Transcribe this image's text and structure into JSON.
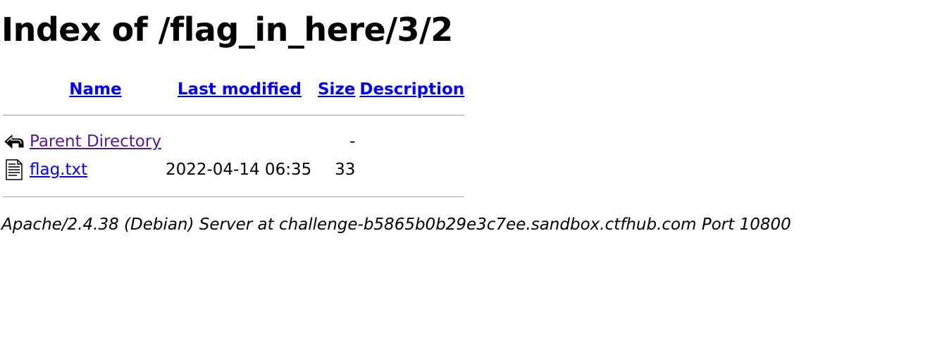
{
  "title": "Index of /flag_in_here/3/2",
  "columns": {
    "name": "Name",
    "last_modified": "Last modified",
    "size": "Size",
    "description": "Description"
  },
  "entries": [
    {
      "icon": "back-arrow-icon",
      "name": "Parent Directory",
      "last_modified": "",
      "size": "-",
      "description": "",
      "visited": true
    },
    {
      "icon": "text-file-icon",
      "name": "flag.txt",
      "last_modified": "2022-04-14 06:35",
      "size": "33",
      "description": "",
      "visited": false
    }
  ],
  "footer": "Apache/2.4.38 (Debian) Server at challenge-b5865b0b29e3c7ee.sandbox.ctfhub.com Port 10800",
  "colors": {
    "link": "#0000ee",
    "visited_link": "#551a8b",
    "rule": "#a0a0a0"
  }
}
